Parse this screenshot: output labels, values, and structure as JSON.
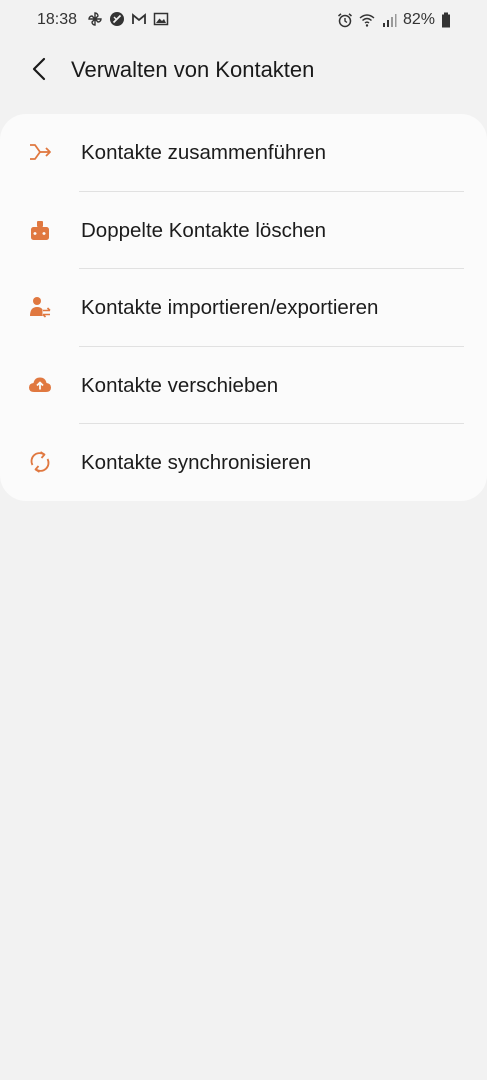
{
  "status_bar": {
    "time": "18:38",
    "left_icons": [
      "pinwheel-icon",
      "blocked-icon",
      "gmail-icon",
      "gallery-icon"
    ],
    "right_icons": [
      "alarm-icon",
      "wifi-icon",
      "signal-icon"
    ],
    "battery": "82%"
  },
  "header": {
    "back_icon": "chevron-left-icon",
    "title": "Verwalten von Kontakten"
  },
  "menu": {
    "items": [
      {
        "label": "Kontakte zusammenführen",
        "icon": "merge-icon"
      },
      {
        "label": "Doppelte Kontakte löschen",
        "icon": "cleanup-brush-icon"
      },
      {
        "label": "Kontakte importieren/exportieren",
        "icon": "person-transfer-icon"
      },
      {
        "label": "Kontakte verschieben",
        "icon": "cloud-upload-icon"
      },
      {
        "label": "Kontakte synchronisieren",
        "icon": "sync-icon"
      }
    ]
  },
  "colors": {
    "accent": "#e07840",
    "background": "#f2f2f2",
    "card": "#fbfbfb"
  }
}
